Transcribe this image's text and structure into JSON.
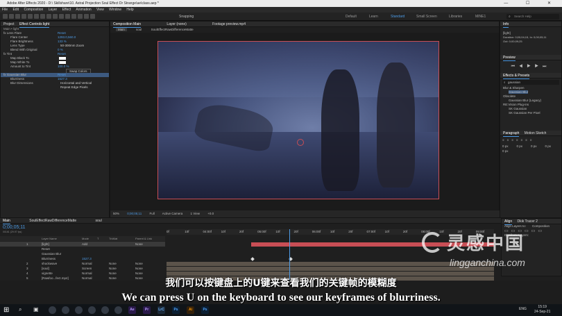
{
  "window": {
    "title": "Adobe After Effects 2020 - D:\\ Skillshare\\10. Astral Projection Soul Effect Dr Strange\\ae\\class.aep *",
    "controls": "— ☐ ✕"
  },
  "menu": [
    "File",
    "Edit",
    "Composition",
    "Layer",
    "Effect",
    "Animation",
    "View",
    "Window",
    "Help"
  ],
  "toolbar": {
    "snapping": "Snapping",
    "workspaces": [
      "Default",
      "Learn",
      "Standard",
      "Small Screen",
      "Libraries",
      "MINE1"
    ],
    "active_workspace": "Standard",
    "search_placeholder": "Search Help"
  },
  "left_panel": {
    "tabs": [
      "Project",
      "Effect Controls light"
    ],
    "breadcrumb": "Main • light",
    "effects": [
      {
        "label": "fx  Lens Flare",
        "value": "Reset",
        "kind": "head"
      },
      {
        "label": "Flare Center",
        "value": "1293.0,560.0",
        "kind": "val"
      },
      {
        "label": "Flare Brightness",
        "value": "133 %",
        "kind": "val"
      },
      {
        "label": "Lens Type",
        "value": "50-300mm Zoom",
        "kind": "txt"
      },
      {
        "label": "Blend With Original",
        "value": "0 %",
        "kind": "val"
      },
      {
        "label": "fx  Tint",
        "value": "Reset",
        "kind": "head"
      },
      {
        "label": "Map Black To",
        "value": "",
        "kind": "swatch-white"
      },
      {
        "label": "Map White To",
        "value": "",
        "kind": "swatch-white"
      },
      {
        "label": "Amount to Tint",
        "value": "100.0 %",
        "kind": "val"
      },
      {
        "label": "",
        "value": "Swap Colors",
        "kind": "btn"
      },
      {
        "label": "fx  Gaussian Blur",
        "value": "Reset",
        "kind": "head-hl"
      },
      {
        "label": "Blurriness",
        "value": "1527.3",
        "kind": "val"
      },
      {
        "label": "Blur Dimensions",
        "value": "Horizontal and Vertical",
        "kind": "txt"
      },
      {
        "label": "",
        "value": "Repeat Edge Pixels",
        "kind": "check"
      }
    ]
  },
  "viewer": {
    "tabs": [
      "Composition Main",
      "Layer (none)",
      "Footage preview.mp4"
    ],
    "subtabs": [
      "Main",
      "soul",
      "SoulEffectRawDifferenceMatte"
    ],
    "controls": [
      "50%",
      "0;00;05;11",
      "Full",
      "Active Camera",
      "1 View",
      "+0.0"
    ]
  },
  "right_panel": {
    "info_title": "Info",
    "info_lines": [
      "[light]",
      "Duration: 0;00;04;15, In: 0;00;05;11",
      "Out: 0;00;09;25"
    ],
    "preview_title": "Preview",
    "fxpresets_title": "Effects & Presets",
    "search_value": "gaussian",
    "tree": [
      {
        "label": "Blur & Sharpen",
        "indent": 0
      },
      {
        "label": "Gaussian Blur",
        "indent": 2,
        "hl": true
      },
      {
        "label": "Obsolete",
        "indent": 0
      },
      {
        "label": "Gaussian Blur (Legacy)",
        "indent": 2
      },
      {
        "label": "RE:Vision Plug-ins",
        "indent": 0
      },
      {
        "label": "SK Gaussian",
        "indent": 2
      },
      {
        "label": "SK Gaussian Per Pixel",
        "indent": 2
      }
    ],
    "paragraph_title": "Paragraph",
    "motion_sketch": "Motion Sketch",
    "para_values": [
      "0 px",
      "0 px",
      "0 px",
      "0 px",
      "0 px"
    ],
    "align_title": "Align",
    "align_tab2": "Dkik Tracer 2",
    "align_layers_to": "Align Layers to:",
    "align_target": "Composition",
    "distribute": "Distribute Layers:"
  },
  "timeline": {
    "tabs": [
      "Main",
      "SoulEffectRawDifferenceMatte",
      "soul"
    ],
    "timecode": "0;00;05;11",
    "timecode_sub": "00161 (29.97 fps)",
    "columns": [
      "Layer Name",
      "Mode",
      "T",
      "TrkMat",
      "Parent & Link"
    ],
    "ruler": [
      "0f",
      "10f",
      "04:00f",
      "10f",
      "20f",
      "05:00f",
      "10f",
      "20f",
      "06:00f",
      "10f",
      "20f",
      "07:00f",
      "10f",
      "20f",
      "08:00f",
      "10f",
      "20f",
      "09:00f"
    ],
    "layers": [
      {
        "num": "1",
        "name": "[light]",
        "mode": "Add",
        "trk": "",
        "parent": "None",
        "sel": true
      },
      {
        "num": "",
        "name": "Reset",
        "mode": "",
        "trk": "",
        "parent": "",
        "sel": false
      },
      {
        "num": "",
        "name": "Gaussian Blur",
        "mode": "",
        "trk": "",
        "parent": "",
        "sel": false
      },
      {
        "num": "",
        "name": "Blurriness",
        "mode": "1527.3",
        "trk": "",
        "parent": "",
        "sel": false
      },
      {
        "num": "2",
        "name": "shockwave",
        "mode": "Normal",
        "trk": "None",
        "parent": "None",
        "sel": false
      },
      {
        "num": "3",
        "name": "[soul]",
        "mode": "Screen",
        "trk": "None",
        "parent": "None",
        "sel": false
      },
      {
        "num": "4",
        "name": "vignette",
        "mode": "Normal",
        "trk": "None",
        "parent": "None",
        "sel": false
      },
      {
        "num": "5",
        "name": "[Rawfoo...fect.mp4]",
        "mode": "Normal",
        "trk": "None",
        "parent": "None",
        "sel": false
      }
    ]
  },
  "subtitles": {
    "cn": "我们可以按键盘上的U键来查看我们的关键帧的模糊度",
    "en": "We can press U on the keyboard to see our keyframes of blurriness."
  },
  "watermark": {
    "cn": "灵感中国",
    "en": "lingganchina.com"
  },
  "taskbar": {
    "apps": [
      "Ae",
      "Pr",
      "LrC",
      "Ps",
      "Ai",
      "Ps"
    ],
    "tray_lang": "ENG",
    "time": "15:19",
    "date": "24-Sep-21"
  },
  "colors": {
    "accent": "#4d9be6",
    "layer_red": "#c84e55",
    "keyframe_bar": "#e0e0e0"
  }
}
